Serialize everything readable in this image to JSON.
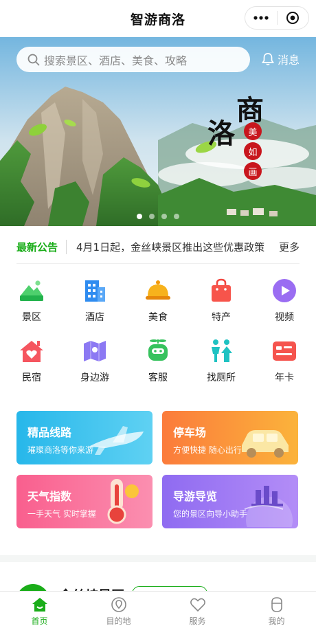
{
  "header": {
    "title": "智游商洛"
  },
  "banner": {
    "search_placeholder": "搜索景区、酒店、美食、攻略",
    "message_label": "消息",
    "calligraphy": [
      "商",
      "洛"
    ],
    "seals": [
      "美",
      "如",
      "画"
    ],
    "slides_total": 4,
    "slide_active": 1
  },
  "notice": {
    "label": "最新公告",
    "text": "4月1日起，金丝峡景区推出这些优惠政策",
    "more": "更多"
  },
  "grid": {
    "row1": [
      {
        "label": "景区",
        "icon": "mountain-icon",
        "color": "#2ec45b"
      },
      {
        "label": "酒店",
        "icon": "building-icon",
        "color": "#2f8cf0"
      },
      {
        "label": "美食",
        "icon": "food-cloche-icon",
        "color": "#f6a20e"
      },
      {
        "label": "特产",
        "icon": "shopping-bag-icon",
        "color": "#f7544b"
      },
      {
        "label": "视频",
        "icon": "play-icon",
        "color": "#9a6df2"
      }
    ],
    "row2": [
      {
        "label": "民宿",
        "icon": "house-heart-icon",
        "color": "#f5555f"
      },
      {
        "label": "身边游",
        "icon": "map-icon",
        "color": "#8c79f3"
      },
      {
        "label": "客服",
        "icon": "robot-icon",
        "color": "#37c25e"
      },
      {
        "label": "找厕所",
        "icon": "restroom-icon",
        "color": "#1fc2c2"
      },
      {
        "label": "年卡",
        "icon": "card-icon",
        "color": "#f5544e"
      }
    ]
  },
  "cards": [
    {
      "title": "精品线路",
      "subtitle": "璀璨商洛等你来游",
      "icon": "airplane-icon"
    },
    {
      "title": "停车场",
      "subtitle": "方便快捷 随心出行",
      "icon": "car-icon"
    },
    {
      "title": "天气指数",
      "subtitle": "一手天气 实时掌握",
      "icon": "thermometer-sun-icon"
    },
    {
      "title": "导游导览",
      "subtitle": "您的景区向导小助手",
      "icon": "landmark-icon"
    }
  ],
  "peek": {
    "title": "金丝峡景区"
  },
  "tabbar": [
    {
      "label": "首页",
      "icon": "home-icon",
      "active": true
    },
    {
      "label": "目的地",
      "icon": "location-icon",
      "active": false
    },
    {
      "label": "服务",
      "icon": "heart-icon",
      "active": false
    },
    {
      "label": "我的",
      "icon": "profile-icon",
      "active": false
    }
  ],
  "colors": {
    "accent": "#1aad19"
  }
}
